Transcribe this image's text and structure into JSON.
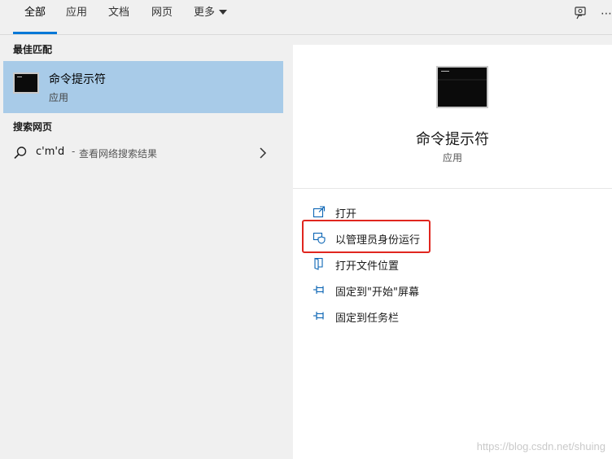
{
  "tabs": [
    {
      "label": "全部",
      "active": true
    },
    {
      "label": "应用",
      "active": false
    },
    {
      "label": "文档",
      "active": false
    },
    {
      "label": "网页",
      "active": false
    },
    {
      "label": "更多",
      "active": false
    }
  ],
  "left": {
    "best_match_title": "最佳匹配",
    "best_match": {
      "name": "命令提示符",
      "type": "应用",
      "icon": "command-prompt-icon"
    },
    "web_title": "搜索网页",
    "web_result": {
      "query": "c'm'd",
      "separator": "-",
      "description": "查看网络搜索结果"
    }
  },
  "detail": {
    "name": "命令提示符",
    "type": "应用",
    "actions": [
      {
        "label": "打开",
        "icon": "open-icon"
      },
      {
        "label": "以管理员身份运行",
        "icon": "run-as-admin-icon"
      },
      {
        "label": "打开文件位置",
        "icon": "file-location-icon"
      },
      {
        "label": "固定到\"开始\"屏幕",
        "icon": "pin-icon"
      },
      {
        "label": "固定到任务栏",
        "icon": "pin-icon"
      }
    ]
  },
  "watermark": "https://blog.csdn.net/shuing",
  "colors": {
    "accent": "#0078d7",
    "selected_bg": "#a8cbe8",
    "highlight": "#e0261f"
  }
}
